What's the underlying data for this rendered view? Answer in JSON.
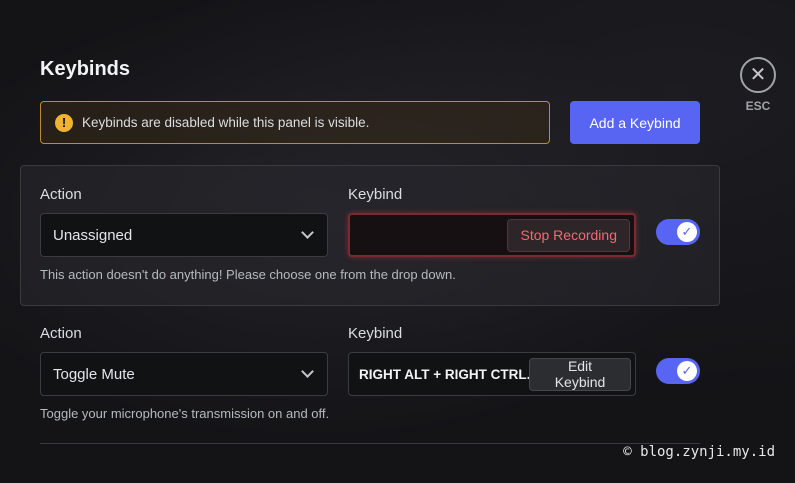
{
  "header": {
    "title": "Keybinds"
  },
  "warning": {
    "icon": "warning-icon",
    "text": "Keybinds are disabled while this panel is visible."
  },
  "actions": {
    "add_keybind_label": "Add a Keybind",
    "close_label": "ESC",
    "close_glyph": "✕"
  },
  "keybinds": [
    {
      "action_label": "Action",
      "action_value": "Unassigned",
      "keybind_label": "Keybind",
      "keybind_value": "",
      "button_label": "Stop Recording",
      "recording": true,
      "enabled": true,
      "description": "This action doesn't do anything! Please choose one from the drop down."
    },
    {
      "action_label": "Action",
      "action_value": "Toggle Mute",
      "keybind_label": "Keybind",
      "keybind_value": "RIGHT ALT + RIGHT CTRL...",
      "button_label": "Edit Keybind",
      "recording": false,
      "enabled": true,
      "description": "Toggle your microphone's transmission on and off."
    }
  ],
  "watermark": "© blog.zynji.my.id",
  "colors": {
    "accent": "#5865f2",
    "warning": "#f0b232",
    "recording": "#f06c70"
  }
}
